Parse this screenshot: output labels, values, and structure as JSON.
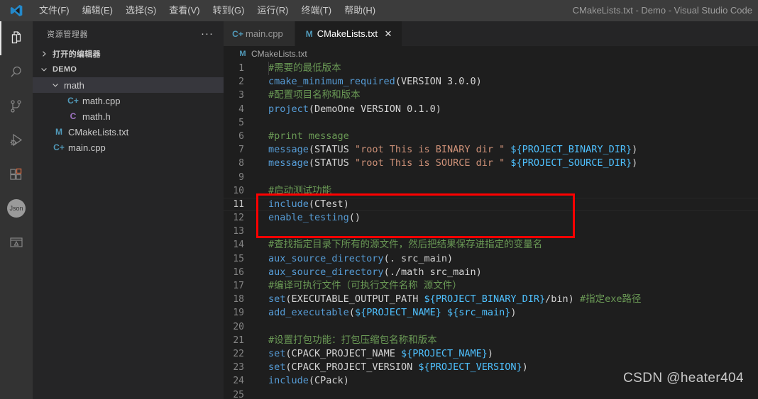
{
  "titlebar": {
    "logo_icon": "vscode-logo-icon",
    "window_title": "CMakeLists.txt - Demo - Visual Studio Code",
    "menu": [
      {
        "label": "文件(F)",
        "name": "menu-file"
      },
      {
        "label": "编辑(E)",
        "name": "menu-edit"
      },
      {
        "label": "选择(S)",
        "name": "menu-selection"
      },
      {
        "label": "查看(V)",
        "name": "menu-view"
      },
      {
        "label": "转到(G)",
        "name": "menu-go"
      },
      {
        "label": "运行(R)",
        "name": "menu-run"
      },
      {
        "label": "终端(T)",
        "name": "menu-terminal"
      },
      {
        "label": "帮助(H)",
        "name": "menu-help"
      }
    ]
  },
  "activitybar": {
    "items": [
      {
        "name": "activity-explorer",
        "icon": "files-icon",
        "active": true
      },
      {
        "name": "activity-search",
        "icon": "search-icon",
        "active": false
      },
      {
        "name": "activity-source-control",
        "icon": "source-control-icon",
        "active": false
      },
      {
        "name": "activity-run-debug",
        "icon": "run-debug-icon",
        "active": false
      },
      {
        "name": "activity-extensions",
        "icon": "extensions-icon",
        "active": false
      },
      {
        "name": "activity-json",
        "icon": "json-icon",
        "label": "Json",
        "active": false
      },
      {
        "name": "activity-preview",
        "icon": "preview-icon",
        "active": false
      }
    ]
  },
  "sidebar": {
    "title": "资源管理器",
    "more_actions": "···",
    "sections": [
      {
        "label": "打开的编辑器",
        "name": "section-open-editors",
        "expanded": false
      },
      {
        "label": "DEMO",
        "name": "section-demo",
        "expanded": true
      }
    ],
    "tree": [
      {
        "label": "math",
        "name": "tree-item-math",
        "kind": "folder",
        "expanded": true,
        "selected": true,
        "indent": 1
      },
      {
        "label": "math.cpp",
        "name": "tree-item-math-cpp",
        "kind": "cpp",
        "icon_glyph": "C+",
        "indent": 2
      },
      {
        "label": "math.h",
        "name": "tree-item-math-h",
        "kind": "header",
        "icon_glyph": "C",
        "indent": 2
      },
      {
        "label": "CMakeLists.txt",
        "name": "tree-item-cmakelists",
        "kind": "cmake",
        "icon_glyph": "M",
        "indent": 1
      },
      {
        "label": "main.cpp",
        "name": "tree-item-main-cpp",
        "kind": "cpp",
        "icon_glyph": "C+",
        "indent": 1
      }
    ]
  },
  "editor": {
    "tabs": [
      {
        "label": "main.cpp",
        "name": "tab-main-cpp",
        "icon_glyph": "C+",
        "icon_kind": "cpp",
        "active": false,
        "closable": false
      },
      {
        "label": "CMakeLists.txt",
        "name": "tab-cmakelists",
        "icon_glyph": "M",
        "icon_kind": "cmake",
        "active": true,
        "closable": true,
        "close_glyph": "✕"
      }
    ],
    "breadcrumb": {
      "label": "CMakeLists.txt",
      "icon_glyph": "M"
    },
    "current_line": 11,
    "lines": [
      {
        "n": 1,
        "indent_guide": true,
        "tokens": [
          {
            "t": "#需要的最低版本",
            "c": "cmt"
          }
        ]
      },
      {
        "n": 2,
        "tokens": [
          {
            "t": "cmake_minimum_required",
            "c": "fn"
          },
          {
            "t": "(",
            "c": "punc"
          },
          {
            "t": "VERSION 3.0.0",
            "c": "id"
          },
          {
            "t": ")",
            "c": "punc"
          }
        ]
      },
      {
        "n": 3,
        "tokens": [
          {
            "t": "#配置项目名称和版本",
            "c": "cmt"
          }
        ]
      },
      {
        "n": 4,
        "tokens": [
          {
            "t": "project",
            "c": "fn"
          },
          {
            "t": "(",
            "c": "punc"
          },
          {
            "t": "DemoOne VERSION 0.1.0",
            "c": "id"
          },
          {
            "t": ")",
            "c": "punc"
          }
        ]
      },
      {
        "n": 5,
        "tokens": []
      },
      {
        "n": 6,
        "tokens": [
          {
            "t": "#print message",
            "c": "cmt"
          }
        ]
      },
      {
        "n": 7,
        "tokens": [
          {
            "t": "message",
            "c": "fn"
          },
          {
            "t": "(",
            "c": "punc"
          },
          {
            "t": "STATUS ",
            "c": "id"
          },
          {
            "t": "\"root This is BINARY dir \"",
            "c": "str"
          },
          {
            "t": " ",
            "c": "id"
          },
          {
            "t": "${PROJECT_BINARY_DIR}",
            "c": "var"
          },
          {
            "t": ")",
            "c": "punc"
          }
        ]
      },
      {
        "n": 8,
        "tokens": [
          {
            "t": "message",
            "c": "fn"
          },
          {
            "t": "(",
            "c": "punc"
          },
          {
            "t": "STATUS ",
            "c": "id"
          },
          {
            "t": "\"root This is SOURCE dir \"",
            "c": "str"
          },
          {
            "t": " ",
            "c": "id"
          },
          {
            "t": "${PROJECT_SOURCE_DIR}",
            "c": "var"
          },
          {
            "t": ")",
            "c": "punc"
          }
        ]
      },
      {
        "n": 9,
        "tokens": []
      },
      {
        "n": 10,
        "tokens": [
          {
            "t": "#启动测试功能",
            "c": "cmt"
          }
        ]
      },
      {
        "n": 11,
        "tokens": [
          {
            "t": "include",
            "c": "fn"
          },
          {
            "t": "(",
            "c": "punc"
          },
          {
            "t": "CTest",
            "c": "id"
          },
          {
            "t": ")",
            "c": "punc"
          }
        ]
      },
      {
        "n": 12,
        "tokens": [
          {
            "t": "enable_testing",
            "c": "fn"
          },
          {
            "t": "()",
            "c": "punc"
          }
        ]
      },
      {
        "n": 13,
        "tokens": []
      },
      {
        "n": 14,
        "tokens": [
          {
            "t": "#查找指定目录下所有的源文件，然后把结果保存进指定的变量名",
            "c": "cmt"
          }
        ]
      },
      {
        "n": 15,
        "tokens": [
          {
            "t": "aux_source_directory",
            "c": "fn"
          },
          {
            "t": "(",
            "c": "punc"
          },
          {
            "t": ". src_main",
            "c": "id"
          },
          {
            "t": ")",
            "c": "punc"
          }
        ]
      },
      {
        "n": 16,
        "tokens": [
          {
            "t": "aux_source_directory",
            "c": "fn"
          },
          {
            "t": "(",
            "c": "punc"
          },
          {
            "t": "./math src_main",
            "c": "id"
          },
          {
            "t": ")",
            "c": "punc"
          }
        ]
      },
      {
        "n": 17,
        "tokens": [
          {
            "t": "#编译可执行文件（可执行文件名称 源文件）",
            "c": "cmt"
          }
        ]
      },
      {
        "n": 18,
        "tokens": [
          {
            "t": "set",
            "c": "fn"
          },
          {
            "t": "(",
            "c": "punc"
          },
          {
            "t": "EXECUTABLE_OUTPUT_PATH ",
            "c": "id"
          },
          {
            "t": "${PROJECT_BINARY_DIR}",
            "c": "var"
          },
          {
            "t": "/bin",
            "c": "id"
          },
          {
            "t": ")",
            "c": "punc"
          },
          {
            "t": " ",
            "c": "id"
          },
          {
            "t": "#指定exe路径",
            "c": "cmt"
          }
        ]
      },
      {
        "n": 19,
        "tokens": [
          {
            "t": "add_executable",
            "c": "fn"
          },
          {
            "t": "(",
            "c": "punc"
          },
          {
            "t": "${PROJECT_NAME}",
            "c": "var"
          },
          {
            "t": " ",
            "c": "id"
          },
          {
            "t": "${src_main}",
            "c": "var"
          },
          {
            "t": ")",
            "c": "punc"
          }
        ]
      },
      {
        "n": 20,
        "tokens": []
      },
      {
        "n": 21,
        "tokens": [
          {
            "t": "#设置打包功能：打包压缩包名称和版本",
            "c": "cmt"
          }
        ]
      },
      {
        "n": 22,
        "tokens": [
          {
            "t": "set",
            "c": "fn"
          },
          {
            "t": "(",
            "c": "punc"
          },
          {
            "t": "CPACK_PROJECT_NAME ",
            "c": "id"
          },
          {
            "t": "${PROJECT_NAME}",
            "c": "var"
          },
          {
            "t": ")",
            "c": "punc"
          }
        ]
      },
      {
        "n": 23,
        "tokens": [
          {
            "t": "set",
            "c": "fn"
          },
          {
            "t": "(",
            "c": "punc"
          },
          {
            "t": "CPACK_PROJECT_VERSION ",
            "c": "id"
          },
          {
            "t": "${PROJECT_VERSION}",
            "c": "var"
          },
          {
            "t": ")",
            "c": "punc"
          }
        ]
      },
      {
        "n": 24,
        "tokens": [
          {
            "t": "include",
            "c": "fn"
          },
          {
            "t": "(",
            "c": "punc"
          },
          {
            "t": "CPack",
            "c": "id"
          },
          {
            "t": ")",
            "c": "punc"
          }
        ]
      },
      {
        "n": 25,
        "tokens": []
      }
    ]
  },
  "annotation": {
    "name": "red-highlight-box",
    "color": "#ff0000",
    "covers_lines": "14-16"
  },
  "watermark": {
    "text": "CSDN @heater404"
  },
  "colors": {
    "titlebar_bg": "#3c3c3c",
    "activitybar_bg": "#333333",
    "sidebar_bg": "#252526",
    "editor_bg": "#1e1e1e",
    "tab_active_bg": "#1e1e1e",
    "tab_inactive_bg": "#2d2d2d",
    "selection_bg": "#37373d",
    "comment": "#6a9955",
    "function": "#569cd6",
    "string": "#ce9178",
    "variable": "#4fc1ff",
    "identifier": "#d4d4d4",
    "linenumber": "#858585",
    "accent_red": "#ff0000"
  }
}
